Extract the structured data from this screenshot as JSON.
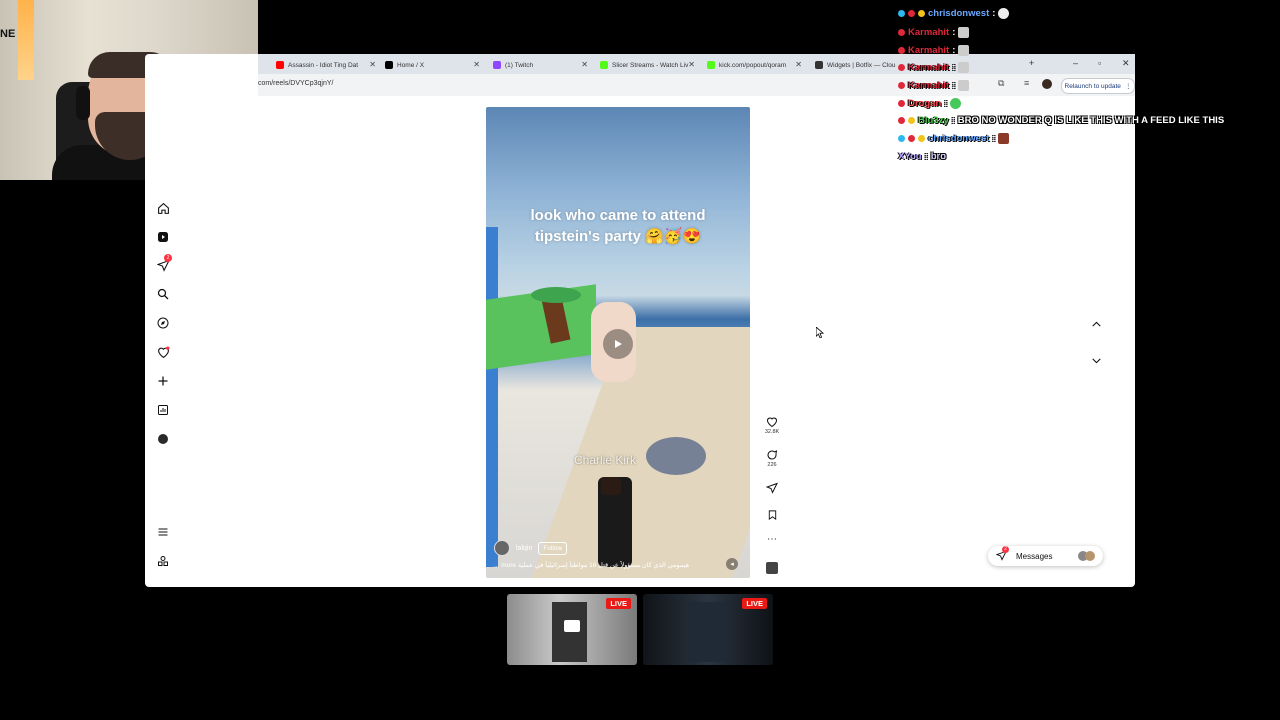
{
  "browser": {
    "tabs": [
      {
        "label": "Assassin - Idiot Ting Dat",
        "favicon_color": "#ff0000"
      },
      {
        "label": "Home / X",
        "favicon_color": "#000000"
      },
      {
        "label": "(1) Twitch",
        "favicon_color": "#9146ff"
      },
      {
        "label": "Slicer Streams - Watch Liv",
        "favicon_color": "#53fc18"
      },
      {
        "label": "kick.com/popout/qoram",
        "favicon_color": "#53fc18"
      },
      {
        "label": "Widgets | Botfix — Clou",
        "favicon_color": "#333333"
      }
    ],
    "url": "com/reels/DVYCp3qjnY/",
    "relaunch_label": "Relaunch to update"
  },
  "sidebar": {
    "notification_count": "2",
    "items": [
      "home-icon",
      "reels-icon",
      "direct-icon",
      "search-icon",
      "explore-icon",
      "notifications-icon",
      "create-icon",
      "dashboard-icon",
      "profile-avatar",
      "menu-icon",
      "also-from-meta-icon"
    ]
  },
  "reel": {
    "caption": "look who came to attend tipstein's party 🤗🥳😍",
    "overlay_text": "Charlie Kirk",
    "username": "lalqin",
    "follow_label": "Follow",
    "description": "... more  هيمومي الذي كان مسؤولاً عن قتل 16 مواطناً إسرائيلياً في عملية",
    "likes": "32.8K",
    "comments": "226"
  },
  "messages": {
    "label": "Messages",
    "badge": "2"
  },
  "chat": [
    {
      "name": "chrisdonwest",
      "name_color": "#6aa8ff",
      "message": ""
    },
    {
      "name": "Karmahit",
      "name_color": "#e0283b",
      "message": ""
    },
    {
      "name": "Karmahit",
      "name_color": "#e0283b",
      "message": ""
    },
    {
      "name": "Karmahit",
      "name_color": "#e0283b",
      "message": ""
    },
    {
      "name": "Karmahit",
      "name_color": "#e0283b",
      "message": ""
    },
    {
      "name": "Drogan",
      "name_color": "#ff4d4d",
      "message": ""
    },
    {
      "name": "Blu3zy",
      "name_color": "#4fc94f",
      "message": "BRO NO WONDER Q IS LIKE THIS WITH A FEED LIKE THIS"
    },
    {
      "name": "chrisdonwest",
      "name_color": "#6aa8ff",
      "message": ""
    },
    {
      "name": "XYou",
      "name_color": "#b9a7ff",
      "message": "bro"
    }
  ],
  "live_thumbs": [
    {
      "badge": "LIVE"
    },
    {
      "badge": "LIVE"
    }
  ]
}
